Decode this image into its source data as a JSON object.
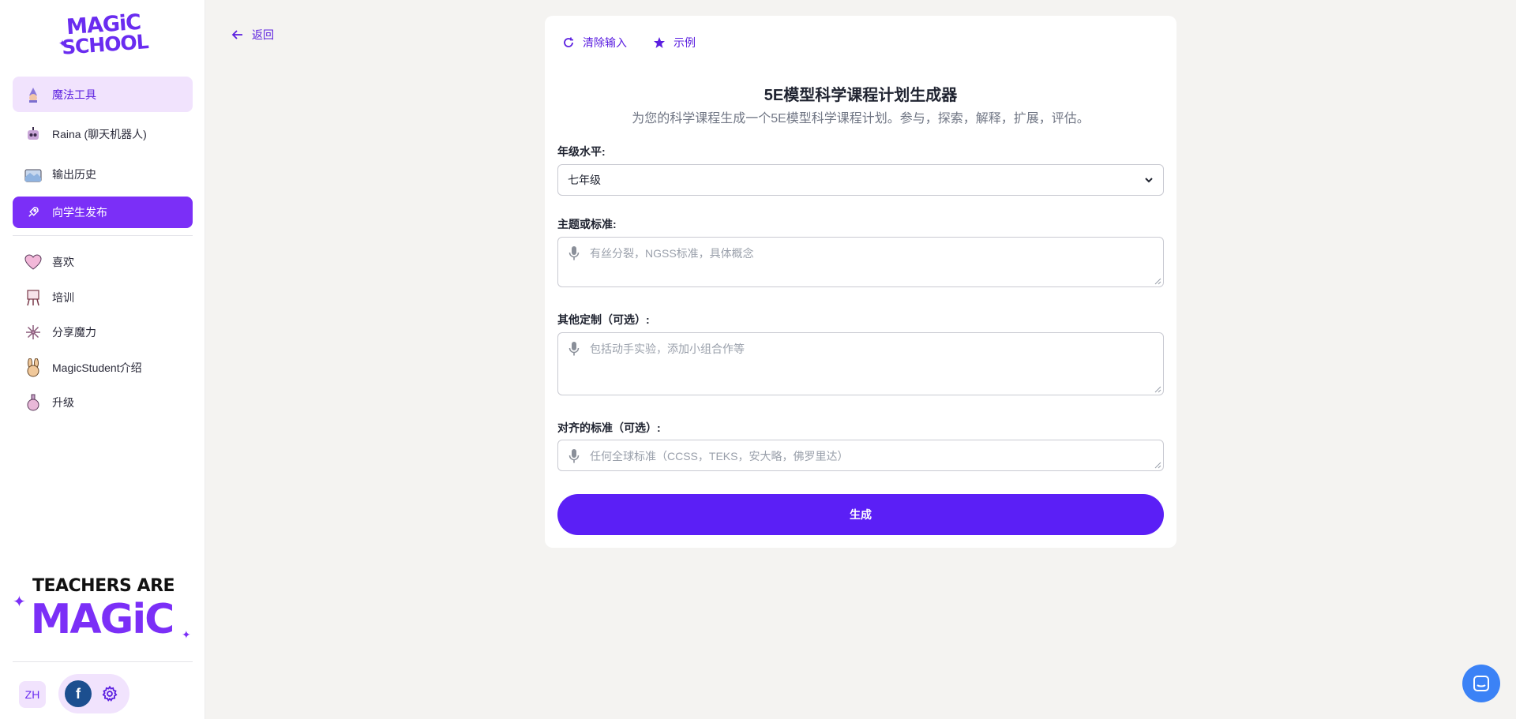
{
  "sidebar": {
    "logo_text_line1": "MAGiC",
    "logo_text_line2": "SCHOOL",
    "items": [
      {
        "label": "魔法工具",
        "icon": "wizard-icon"
      },
      {
        "label": "Raina (聊天机器人)",
        "icon": "robot-icon"
      },
      {
        "label": "输出历史",
        "icon": "history-icon"
      },
      {
        "label": "向学生发布",
        "icon": "rocket-icon"
      },
      {
        "label": "喜欢",
        "icon": "heart-icon"
      },
      {
        "label": "培训",
        "icon": "easel-icon"
      },
      {
        "label": "分享魔力",
        "icon": "sparkle-icon"
      },
      {
        "label": "MagicStudent介绍",
        "icon": "bunny-icon"
      },
      {
        "label": "升级",
        "icon": "potion-icon"
      }
    ],
    "banner_line1": "TEACHERS ARE",
    "banner_line2": "MAGiC",
    "language": "ZH",
    "facebook_letter": "f"
  },
  "back_label": "返回",
  "toolbar": {
    "clear_label": "清除输入",
    "example_label": "示例"
  },
  "form": {
    "title": "5E模型科学课程计划生成器",
    "subtitle": "为您的科学课程生成一个5E模型科学课程计划。参与，探索，解释，扩展，评估。",
    "grade_label": "年级水平:",
    "grade_value": "七年级",
    "topic_label": "主题或标准:",
    "topic_placeholder": "有丝分裂，NGSS标准，具体概念",
    "custom_label": "其他定制（可选）:",
    "custom_placeholder": "包括动手实验，添加小组合作等",
    "standards_label": "对齐的标准（可选）:",
    "standards_placeholder": "任何全球标准（CCSS，TEKS，安大略，佛罗里达）",
    "generate_label": "生成"
  },
  "colors": {
    "accent": "#5b1ff6",
    "sidebar_active": "#7b2ff7",
    "sidebar_soft": "#f1e3fd"
  }
}
